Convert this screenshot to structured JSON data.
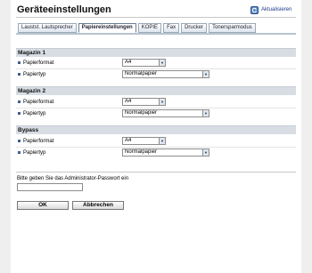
{
  "header": {
    "title": "Geräteeinstellungen",
    "refresh_label": "Aktualisieren"
  },
  "tabs": [
    {
      "label": "Laustst. Lautsprecher",
      "active": false
    },
    {
      "label": "Papiereinstellungen",
      "active": true
    },
    {
      "label": "KOPIE",
      "active": false
    },
    {
      "label": "Fax",
      "active": false
    },
    {
      "label": "Drucker",
      "active": false
    },
    {
      "label": "Tonersparmodus",
      "active": false
    }
  ],
  "sections": [
    {
      "title": "Magazin 1",
      "format_label": "Papierformat",
      "format_value": "A4",
      "type_label": "Papiertyp",
      "type_value": "Normalpapier"
    },
    {
      "title": "Magazin 2",
      "format_label": "Papierformat",
      "format_value": "A4",
      "type_label": "Papiertyp",
      "type_value": "Normalpapier"
    },
    {
      "title": "Bypass",
      "format_label": "Papierformat",
      "format_value": "A4",
      "type_label": "Papiertyp",
      "type_value": "Normalpapier"
    }
  ],
  "password": {
    "label": "Bitte geben Sie das Administrator-Passwort ein",
    "value": ""
  },
  "buttons": {
    "ok_label": "OK",
    "cancel_label": "Abbrechen"
  },
  "colors": {
    "section_header_bg": "#d7dde3",
    "bullet": "#3b5f8e",
    "refresh_link": "#1e3a8a"
  },
  "icons": {
    "refresh": "refresh-icon",
    "bullet": "bullet-icon",
    "dropdown": "chevron-down-icon"
  }
}
